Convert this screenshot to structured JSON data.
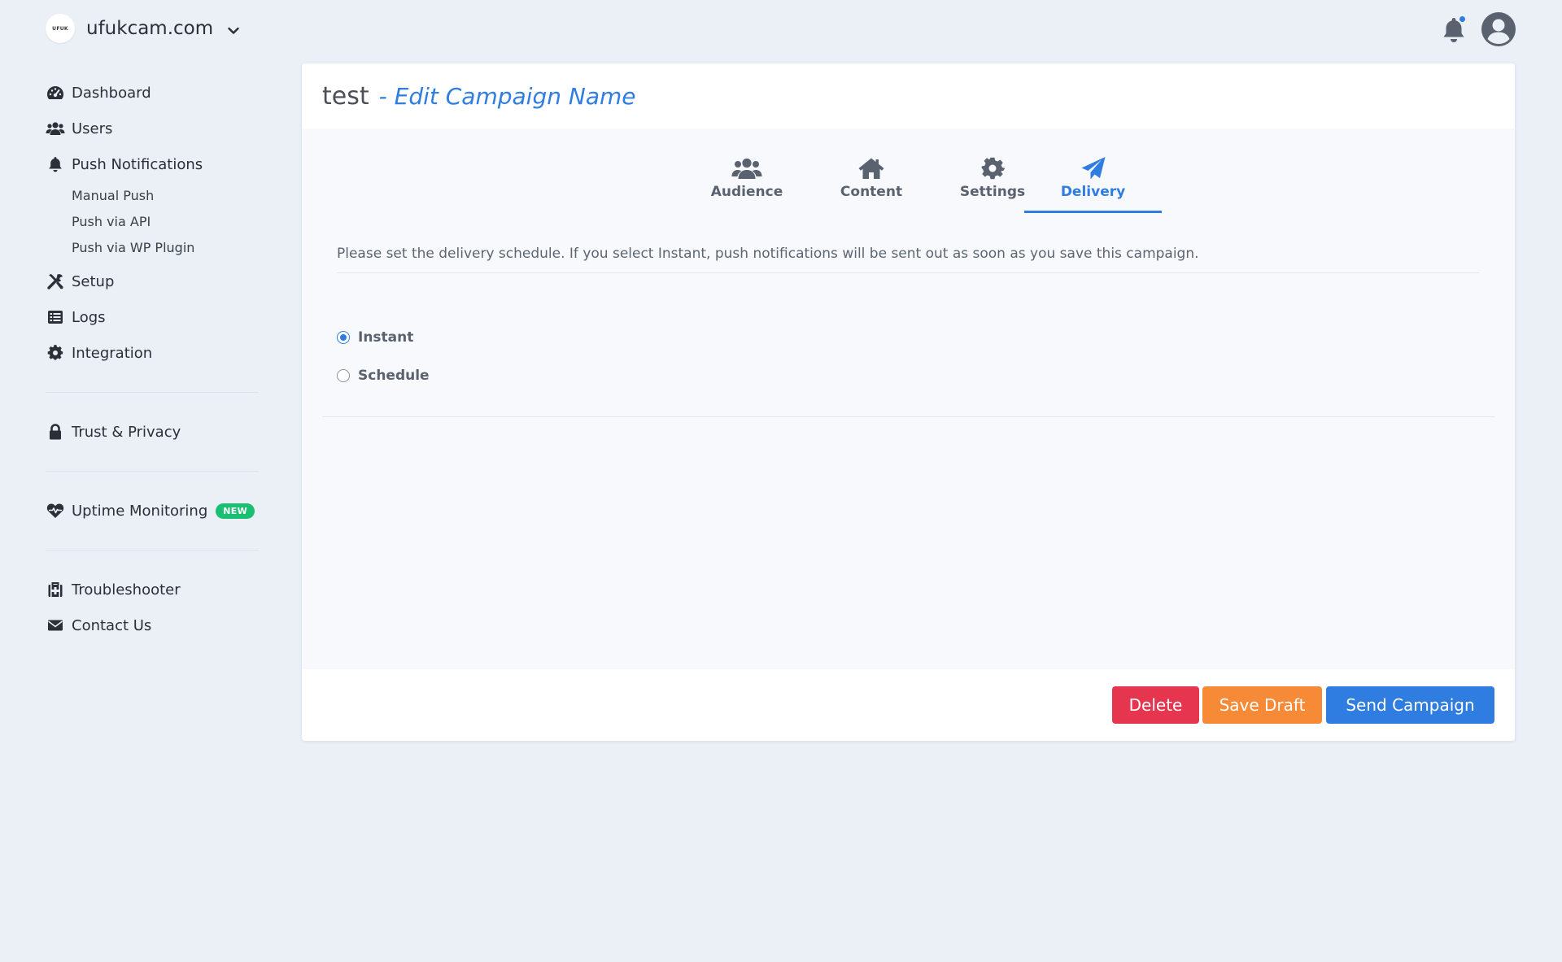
{
  "header": {
    "site_logo_text": "UFUK",
    "site_name": "ufukcam.com"
  },
  "sidebar": {
    "items": [
      {
        "label": "Dashboard",
        "icon": "gauge-icon"
      },
      {
        "label": "Users",
        "icon": "users-icon"
      },
      {
        "label": "Push Notifications",
        "icon": "bell-icon"
      },
      {
        "label": "Setup",
        "icon": "tools-icon"
      },
      {
        "label": "Logs",
        "icon": "list-icon"
      },
      {
        "label": "Integration",
        "icon": "gear-icon"
      }
    ],
    "sub_items": [
      "Manual Push",
      "Push via API",
      "Push via WP Plugin"
    ],
    "trust": {
      "label": "Trust & Privacy",
      "icon": "lock-icon"
    },
    "uptime": {
      "label": "Uptime Monitoring",
      "badge": "NEW",
      "icon": "heartbeat-icon"
    },
    "troubleshooter": {
      "label": "Troubleshooter",
      "icon": "first-aid-icon"
    },
    "contact": {
      "label": "Contact Us",
      "icon": "envelope-icon"
    }
  },
  "campaign": {
    "name": "test",
    "edit_label": "- Edit Campaign Name"
  },
  "tabs": [
    {
      "label": "Audience",
      "icon": "users-icon",
      "active": false
    },
    {
      "label": "Content",
      "icon": "home-icon",
      "active": false
    },
    {
      "label": "Settings",
      "icon": "gear-icon",
      "active": false
    },
    {
      "label": "Delivery",
      "icon": "paper-plane-icon",
      "active": true
    }
  ],
  "delivery": {
    "description": "Please set the delivery schedule. If you select Instant, push notifications will be sent out as soon as you save this campaign.",
    "options": [
      {
        "label": "Instant",
        "selected": true
      },
      {
        "label": "Schedule",
        "selected": false
      }
    ]
  },
  "actions": {
    "delete": "Delete",
    "save_draft": "Save Draft",
    "send": "Send Campaign"
  },
  "colors": {
    "accent": "#2f7de1",
    "danger": "#e6364f",
    "warning": "#f68a36",
    "success": "#1bbf73",
    "background": "#ebf0f7"
  }
}
